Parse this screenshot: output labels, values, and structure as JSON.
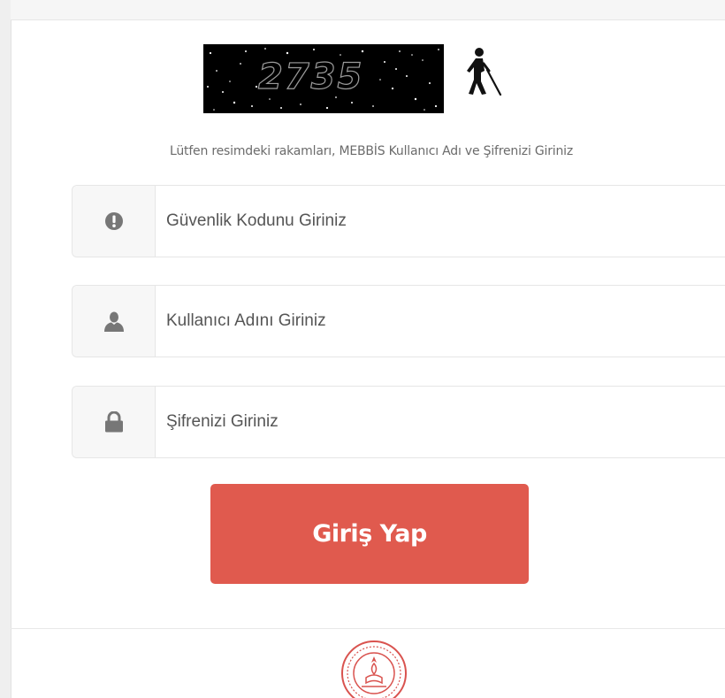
{
  "captcha": {
    "code": "2735",
    "accessibility_icon": "blind-person-icon"
  },
  "instruction_text": "Lütfen resimdeki rakamları, MEBBİS Kullanıcı Adı ve Şifrenizi Giriniz",
  "fields": {
    "security_code": {
      "icon": "exclamation-circle-icon",
      "placeholder": "Güvenlik Kodunu Giriniz",
      "value": ""
    },
    "username": {
      "icon": "user-icon",
      "placeholder": "Kullanıcı Adını Giriniz",
      "value": ""
    },
    "password": {
      "icon": "lock-icon",
      "placeholder": "Şifrenizi Giriniz",
      "value": ""
    }
  },
  "login_button": {
    "label": "Giriş Yap",
    "color": "#e05a4e"
  },
  "footer": {
    "logo_icon": "ministry-seal-logo"
  }
}
